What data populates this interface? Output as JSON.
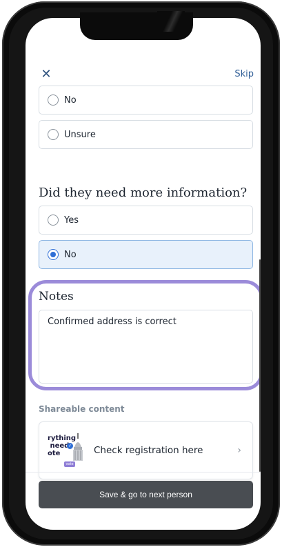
{
  "header": {
    "close_icon": "close-icon",
    "close_glyph": "✕",
    "skip_label": "Skip"
  },
  "previous_question": {
    "options": [
      {
        "label": "No",
        "selected": false
      },
      {
        "label": "Unsure",
        "selected": false
      }
    ]
  },
  "question": {
    "text": "Did they need more information?",
    "options": [
      {
        "label": "Yes",
        "selected": false
      },
      {
        "label": "No",
        "selected": true
      }
    ]
  },
  "notes": {
    "label": "Notes",
    "value": "Confirmed address is correct"
  },
  "shareable": {
    "header": "Shareable content",
    "card": {
      "thumbnail_text": "rything\n need\note",
      "thumbnail_badge": "vote",
      "title": "Check registration here",
      "chevron": "›"
    }
  },
  "footer": {
    "save_label": "Save & go to next person"
  },
  "colors": {
    "accent": "#2f6fd6",
    "highlight": "#9b8bd9",
    "button": "#494d52",
    "link": "#2f5d96"
  }
}
